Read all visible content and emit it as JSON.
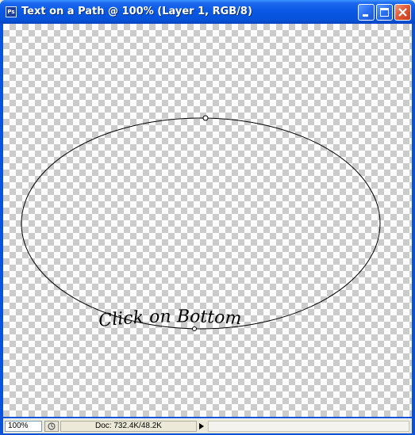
{
  "window": {
    "title": "Text on a Path @ 100% (Layer 1, RGB/8)",
    "app_icon": "Ps"
  },
  "canvas": {
    "path_text": "Click on Bottom"
  },
  "status": {
    "zoom": "100%",
    "doc_info": "Doc: 732.4K/48.2K"
  },
  "colors": {
    "titlebar": "#0a58e3",
    "close_button": "#e05c36",
    "checker_dark": "#cccccc",
    "checker_light": "#ffffff"
  },
  "icons": [
    "app-icon",
    "minimize-icon",
    "maximize-icon",
    "close-icon",
    "status-menu-icon",
    "arrow-right-icon"
  ]
}
